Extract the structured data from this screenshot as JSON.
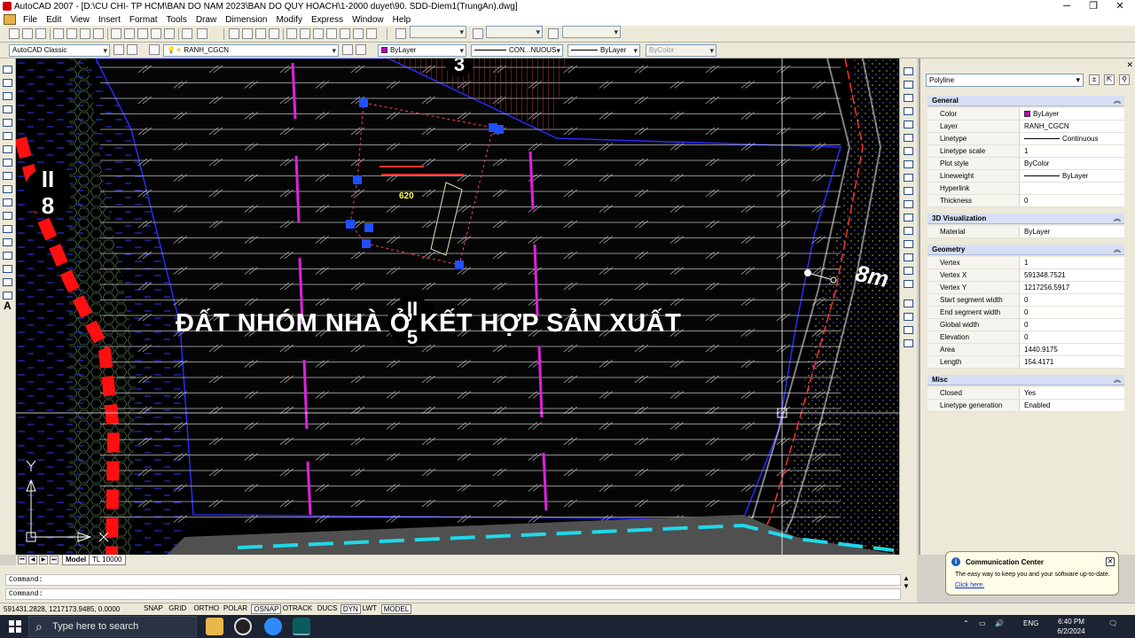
{
  "window": {
    "title": "AutoCAD 2007 - [D:\\CU CHI- TP HCM\\BAN DO NAM 2023\\BAN DO QUY HOACH\\1-2000 duyet\\90. SDD-Diem1(TrungAn).dwg]",
    "controls": [
      "─",
      "❐",
      "✕"
    ]
  },
  "menu": [
    "File",
    "Edit",
    "View",
    "Insert",
    "Format",
    "Tools",
    "Draw",
    "Dimension",
    "Modify",
    "Express",
    "Window",
    "Help"
  ],
  "toolbar2": {
    "workspace": "AutoCAD Classic",
    "layer": "RANH_CGCN",
    "color": "ByLayer",
    "linetype": "CON...NUOUS",
    "lineweight": "ByLayer",
    "plotstyle": "ByColor"
  },
  "drawing": {
    "main_label": "ĐẤT NHÓM NHÀ Ở KẾT HỢP SẢN XUẤT",
    "lot_number": "620",
    "road_width": "8m",
    "road_code_top": "II",
    "road_code_bottom": "8",
    "top_marker": "3",
    "block_top": "II",
    "block_bottom": "5"
  },
  "props": {
    "selection": "Polyline",
    "sections": [
      {
        "title": "General",
        "rows": [
          {
            "k": "Color",
            "v": "ByLayer",
            "swatch": true
          },
          {
            "k": "Layer",
            "v": "RANH_CGCN"
          },
          {
            "k": "Linetype",
            "v": "Continuous",
            "line": true
          },
          {
            "k": "Linetype scale",
            "v": "1"
          },
          {
            "k": "Plot style",
            "v": "ByColor"
          },
          {
            "k": "Lineweight",
            "v": "ByLayer",
            "line": true
          },
          {
            "k": "Hyperlink",
            "v": ""
          },
          {
            "k": "Thickness",
            "v": "0"
          }
        ]
      },
      {
        "title": "3D Visualization",
        "rows": [
          {
            "k": "Material",
            "v": "ByLayer"
          }
        ]
      },
      {
        "title": "Geometry",
        "rows": [
          {
            "k": "Vertex",
            "v": "1"
          },
          {
            "k": "Vertex X",
            "v": "591348.7521"
          },
          {
            "k": "Vertex Y",
            "v": "1217256.5917"
          },
          {
            "k": "Start segment width",
            "v": "0"
          },
          {
            "k": "End segment width",
            "v": "0"
          },
          {
            "k": "Global width",
            "v": "0"
          },
          {
            "k": "Elevation",
            "v": "0"
          },
          {
            "k": "Area",
            "v": "1440.9175"
          },
          {
            "k": "Length",
            "v": "154.4171"
          }
        ]
      },
      {
        "title": "Misc",
        "rows": [
          {
            "k": "Closed",
            "v": "Yes"
          },
          {
            "k": "Linetype generation",
            "v": "Enabled"
          }
        ]
      }
    ]
  },
  "tabs": {
    "model": "Model",
    "layout": "TL 10000"
  },
  "command": {
    "line1": "Command:",
    "line2": "Command:"
  },
  "status": {
    "coords": "591431.2828, 1217173.9485, 0.0000",
    "toggles": [
      {
        "label": "SNAP",
        "on": false
      },
      {
        "label": "GRID",
        "on": false
      },
      {
        "label": "ORTHO",
        "on": false
      },
      {
        "label": "POLAR",
        "on": false
      },
      {
        "label": "OSNAP",
        "on": true
      },
      {
        "label": "OTRACK",
        "on": false
      },
      {
        "label": "DUCS",
        "on": false
      },
      {
        "label": "DYN",
        "on": true
      },
      {
        "label": "LWT",
        "on": false
      },
      {
        "label": "MODEL",
        "on": true
      }
    ]
  },
  "bubble": {
    "title": "Communication Center",
    "message": "The easy way to keep you and your software up-to-date.",
    "link": "Click here."
  },
  "taskbar": {
    "search_placeholder": "Type here to search",
    "lang": "ENG",
    "time": "6:40 PM",
    "date": "6/2/2024"
  },
  "colors": {
    "magenta": "#e020e0",
    "red_dash": "#ff1010",
    "grip_blue": "#1f4fff",
    "road_cyan": "#20d8e8",
    "hatch": "#c8c8c8"
  }
}
